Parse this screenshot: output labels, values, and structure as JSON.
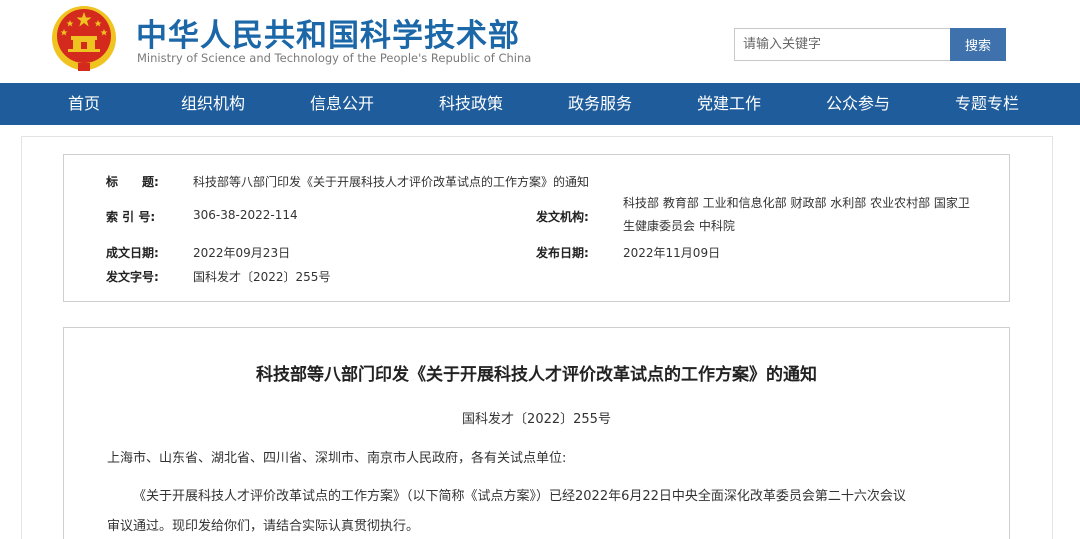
{
  "header": {
    "title": "中华人民共和国科学技术部",
    "subtitle": "Ministry of Science and Technology of the People's Republic of China",
    "search_placeholder": "请输入关键字",
    "search_button": "搜索"
  },
  "nav": {
    "items": [
      "首页",
      "组织机构",
      "信息公开",
      "科技政策",
      "政务服务",
      "党建工作",
      "公众参与",
      "专题专栏"
    ]
  },
  "meta": {
    "title_label": "标　　题:",
    "title_value": "科技部等八部门印发《关于开展科技人才评价改革试点的工作方案》的通知",
    "index_label": "索 引 号:",
    "index_value": "306-38-2022-114",
    "issuer_label": "发文机构:",
    "issuer_value": "科技部 教育部 工业和信息化部 财政部 水利部 农业农村部 国家卫生健康委员会 中科院",
    "created_label": "成文日期:",
    "created_value": "2022年09月23日",
    "published_label": "发布日期:",
    "published_value": "2022年11月09日",
    "docno_label": "发文字号:",
    "docno_value": "国科发才〔2022〕255号"
  },
  "document": {
    "title": "科技部等八部门印发《关于开展科技人才评价改革试点的工作方案》的通知",
    "number": "国科发才〔2022〕255号",
    "recipients": "上海市、山东省、湖北省、四川省、深圳市、南京市人民政府，各有关试点单位:",
    "para1_line1": "《关于开展科技人才评价改革试点的工作方案》（以下简称《试点方案》）已经2022年6月22日中央全面深化改革委员会第二十六次会议",
    "para1_line2": "审议通过。现印发给你们，请结合实际认真贯彻执行。"
  },
  "colors": {
    "brand_blue": "#1b67a8",
    "nav_blue": "#1e5c9b",
    "search_button": "#3f72ad",
    "emblem_red": "#d42a1e",
    "emblem_gold": "#f0c420"
  }
}
